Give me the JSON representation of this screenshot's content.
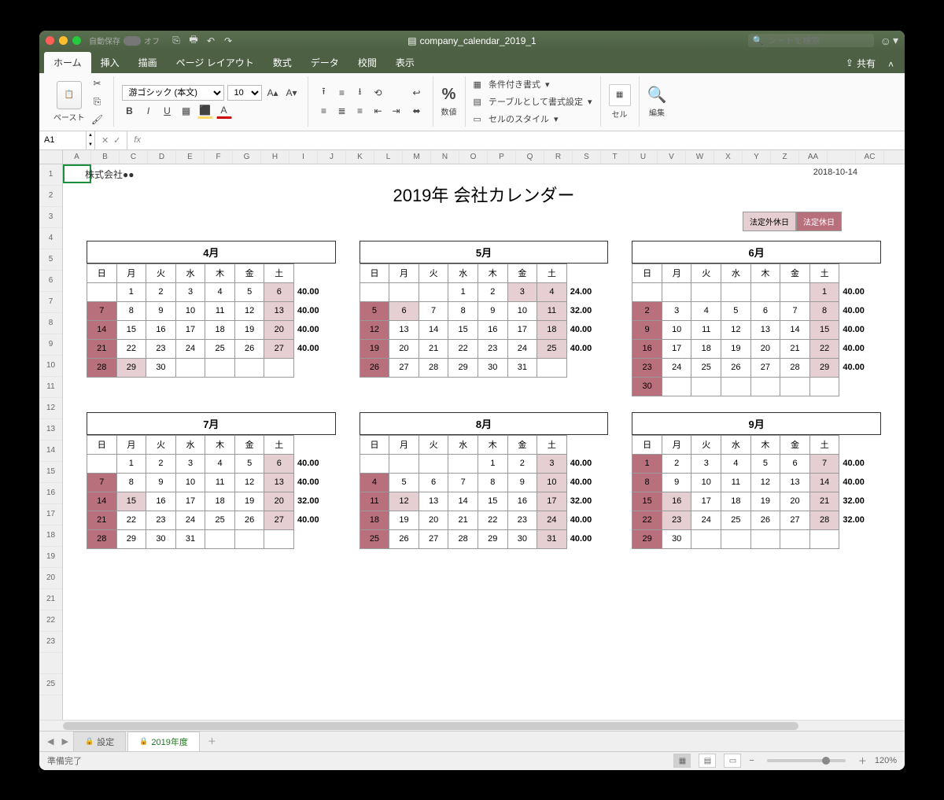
{
  "titlebar": {
    "autosave_label": "自動保存",
    "autosave_state": "オフ",
    "filename": "company_calendar_2019_1",
    "search_placeholder": "シートを検索"
  },
  "tabs": {
    "items": [
      "ホーム",
      "挿入",
      "描画",
      "ページ レイアウト",
      "数式",
      "データ",
      "校閲",
      "表示"
    ],
    "active": 0,
    "share_label": "共有"
  },
  "ribbon": {
    "paste_label": "ペースト",
    "font_name": "游ゴシック (本文)",
    "font_size": "10",
    "number_label": "数値",
    "cond_format": "条件付き書式",
    "table_format": "テーブルとして書式設定",
    "cell_style": "セルのスタイル",
    "cells_label": "セル",
    "edit_label": "編集"
  },
  "formula_bar": {
    "cell_ref": "A1",
    "fx_label": "fx",
    "formula": ""
  },
  "columns": [
    "A",
    "B",
    "C",
    "D",
    "E",
    "F",
    "G",
    "H",
    "I",
    "J",
    "K",
    "L",
    "M",
    "N",
    "O",
    "P",
    "Q",
    "R",
    "S",
    "T",
    "U",
    "V",
    "W",
    "X",
    "Y",
    "Z",
    "AA",
    "",
    "AC"
  ],
  "rows_visible": [
    "1",
    "2",
    "3",
    "4",
    "5",
    "6",
    "7",
    "8",
    "9",
    "10",
    "11",
    "12",
    "13",
    "14",
    "15",
    "16",
    "17",
    "18",
    "19",
    "20",
    "21",
    "22",
    "23",
    "",
    "25"
  ],
  "document": {
    "company": "株式会社●●",
    "date": "2018-10-14",
    "title": "2019年 会社カレンダー",
    "legend": {
      "label1": "法定外休日",
      "label2": "法定休日"
    },
    "weekdays": [
      "日",
      "月",
      "火",
      "水",
      "木",
      "金",
      "土"
    ],
    "months": [
      {
        "name": "4月",
        "weeks": [
          [
            "",
            "1",
            "2",
            "3",
            "4",
            "5",
            "6"
          ],
          [
            "7",
            "8",
            "9",
            "10",
            "11",
            "12",
            "13"
          ],
          [
            "14",
            "15",
            "16",
            "17",
            "18",
            "19",
            "20"
          ],
          [
            "21",
            "22",
            "23",
            "24",
            "25",
            "26",
            "27"
          ],
          [
            "28",
            "29",
            "30",
            "",
            "",
            "",
            ""
          ]
        ],
        "shade": [
          [
            0,
            0,
            0,
            0,
            0,
            0,
            1
          ],
          [
            2,
            0,
            0,
            0,
            0,
            0,
            1
          ],
          [
            2,
            0,
            0,
            0,
            0,
            0,
            1
          ],
          [
            2,
            0,
            0,
            0,
            0,
            0,
            1
          ],
          [
            2,
            1,
            0,
            0,
            0,
            0,
            0
          ]
        ],
        "hours": [
          "40.00",
          "40.00",
          "40.00",
          "40.00",
          ""
        ]
      },
      {
        "name": "5月",
        "weeks": [
          [
            "",
            "",
            "",
            "1",
            "2",
            "3",
            "4"
          ],
          [
            "5",
            "6",
            "7",
            "8",
            "9",
            "10",
            "11"
          ],
          [
            "12",
            "13",
            "14",
            "15",
            "16",
            "17",
            "18"
          ],
          [
            "19",
            "20",
            "21",
            "22",
            "23",
            "24",
            "25"
          ],
          [
            "26",
            "27",
            "28",
            "29",
            "30",
            "31",
            ""
          ]
        ],
        "shade": [
          [
            0,
            0,
            0,
            0,
            0,
            1,
            1
          ],
          [
            2,
            1,
            0,
            0,
            0,
            0,
            1
          ],
          [
            2,
            0,
            0,
            0,
            0,
            0,
            1
          ],
          [
            2,
            0,
            0,
            0,
            0,
            0,
            1
          ],
          [
            2,
            0,
            0,
            0,
            0,
            0,
            0
          ]
        ],
        "hours": [
          "24.00",
          "32.00",
          "40.00",
          "40.00",
          ""
        ]
      },
      {
        "name": "6月",
        "weeks": [
          [
            "",
            "",
            "",
            "",
            "",
            "",
            "1"
          ],
          [
            "2",
            "3",
            "4",
            "5",
            "6",
            "7",
            "8"
          ],
          [
            "9",
            "10",
            "11",
            "12",
            "13",
            "14",
            "15"
          ],
          [
            "16",
            "17",
            "18",
            "19",
            "20",
            "21",
            "22"
          ],
          [
            "23",
            "24",
            "25",
            "26",
            "27",
            "28",
            "29"
          ],
          [
            "30",
            "",
            "",
            "",
            "",
            "",
            ""
          ]
        ],
        "shade": [
          [
            0,
            0,
            0,
            0,
            0,
            0,
            1
          ],
          [
            2,
            0,
            0,
            0,
            0,
            0,
            1
          ],
          [
            2,
            0,
            0,
            0,
            0,
            0,
            1
          ],
          [
            2,
            0,
            0,
            0,
            0,
            0,
            1
          ],
          [
            2,
            0,
            0,
            0,
            0,
            0,
            1
          ],
          [
            2,
            0,
            0,
            0,
            0,
            0,
            0
          ]
        ],
        "hours": [
          "40.00",
          "40.00",
          "40.00",
          "40.00",
          "40.00",
          ""
        ]
      },
      {
        "name": "7月",
        "weeks": [
          [
            "",
            "1",
            "2",
            "3",
            "4",
            "5",
            "6"
          ],
          [
            "7",
            "8",
            "9",
            "10",
            "11",
            "12",
            "13"
          ],
          [
            "14",
            "15",
            "16",
            "17",
            "18",
            "19",
            "20"
          ],
          [
            "21",
            "22",
            "23",
            "24",
            "25",
            "26",
            "27"
          ],
          [
            "28",
            "29",
            "30",
            "31",
            "",
            "",
            ""
          ]
        ],
        "shade": [
          [
            0,
            0,
            0,
            0,
            0,
            0,
            1
          ],
          [
            2,
            0,
            0,
            0,
            0,
            0,
            1
          ],
          [
            2,
            1,
            0,
            0,
            0,
            0,
            1
          ],
          [
            2,
            0,
            0,
            0,
            0,
            0,
            1
          ],
          [
            2,
            0,
            0,
            0,
            0,
            0,
            0
          ]
        ],
        "hours": [
          "40.00",
          "40.00",
          "32.00",
          "40.00",
          ""
        ]
      },
      {
        "name": "8月",
        "weeks": [
          [
            "",
            "",
            "",
            "",
            "1",
            "2",
            "3"
          ],
          [
            "4",
            "5",
            "6",
            "7",
            "8",
            "9",
            "10"
          ],
          [
            "11",
            "12",
            "13",
            "14",
            "15",
            "16",
            "17"
          ],
          [
            "18",
            "19",
            "20",
            "21",
            "22",
            "23",
            "24"
          ],
          [
            "25",
            "26",
            "27",
            "28",
            "29",
            "30",
            "31"
          ]
        ],
        "shade": [
          [
            0,
            0,
            0,
            0,
            0,
            0,
            1
          ],
          [
            2,
            0,
            0,
            0,
            0,
            0,
            1
          ],
          [
            2,
            1,
            0,
            0,
            0,
            0,
            1
          ],
          [
            2,
            0,
            0,
            0,
            0,
            0,
            1
          ],
          [
            2,
            0,
            0,
            0,
            0,
            0,
            1
          ]
        ],
        "hours": [
          "40.00",
          "40.00",
          "32.00",
          "40.00",
          "40.00"
        ]
      },
      {
        "name": "9月",
        "weeks": [
          [
            "1",
            "2",
            "3",
            "4",
            "5",
            "6",
            "7"
          ],
          [
            "8",
            "9",
            "10",
            "11",
            "12",
            "13",
            "14"
          ],
          [
            "15",
            "16",
            "17",
            "18",
            "19",
            "20",
            "21"
          ],
          [
            "22",
            "23",
            "24",
            "25",
            "26",
            "27",
            "28"
          ],
          [
            "29",
            "30",
            "",
            "",
            "",
            "",
            ""
          ]
        ],
        "shade": [
          [
            2,
            0,
            0,
            0,
            0,
            0,
            1
          ],
          [
            2,
            0,
            0,
            0,
            0,
            0,
            1
          ],
          [
            2,
            1,
            0,
            0,
            0,
            0,
            1
          ],
          [
            2,
            1,
            0,
            0,
            0,
            0,
            1
          ],
          [
            2,
            0,
            0,
            0,
            0,
            0,
            0
          ]
        ],
        "hours": [
          "40.00",
          "40.00",
          "32.00",
          "32.00",
          ""
        ]
      }
    ]
  },
  "sheet_tabs": {
    "items": [
      {
        "label": "設定",
        "locked": true,
        "active": false
      },
      {
        "label": "2019年度",
        "locked": true,
        "active": true
      }
    ]
  },
  "statusbar": {
    "ready": "準備完了",
    "zoom": "120%"
  }
}
